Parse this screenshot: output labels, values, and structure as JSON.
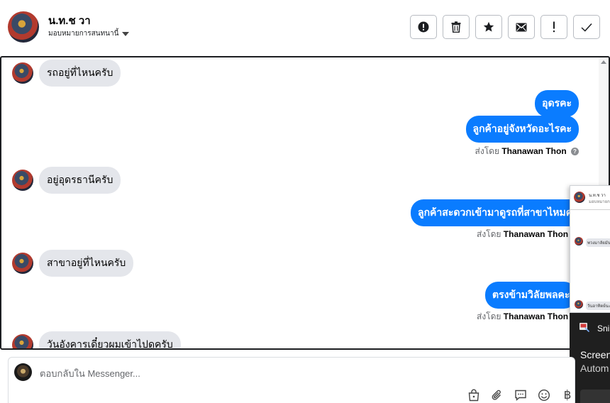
{
  "header": {
    "contact_name": "น.ท.ช วา",
    "assign_label": "มอบหมายการสนทนานี้"
  },
  "toolbar": {
    "buttons": [
      {
        "icon": "alert-circle-icon"
      },
      {
        "icon": "trash-icon"
      },
      {
        "icon": "star-icon"
      },
      {
        "icon": "envelope-icon"
      },
      {
        "icon": "exclamation-icon"
      },
      {
        "icon": "check-icon"
      }
    ]
  },
  "messages": [
    {
      "direction": "in",
      "text": "รถอยู่ที่ไหนครับ"
    },
    {
      "direction": "out",
      "text": "อุดรคะ"
    },
    {
      "direction": "out",
      "text": "ลูกค้าอยู่จังหวัดอะไรคะ"
    },
    {
      "direction": "meta",
      "prefix": "ส่งโดย",
      "sender": "Thanawan Thon"
    },
    {
      "direction": "in",
      "text": "อยู่อุดรธานีครับ"
    },
    {
      "direction": "out",
      "text": "ลูกค้าสะดวกเข้ามาดูรถที่สาขาไหมคะ"
    },
    {
      "direction": "meta",
      "prefix": "ส่งโดย",
      "sender": "Thanawan Thon"
    },
    {
      "direction": "in",
      "text": "สาขาอยู่ที่ไหนครับ"
    },
    {
      "direction": "out",
      "text": "ตรงข้ามวิลัยพลคะ"
    },
    {
      "direction": "meta",
      "prefix": "ส่งโดย",
      "sender": "Thanawan Thon"
    },
    {
      "direction": "in",
      "text": "วันอังคารเดี๋ยวผมเข้าไปดูครับ"
    }
  ],
  "thumbnail": {
    "name": "น.ท.ช วา",
    "sub": "มอบหมายการส",
    "msg1": "พวงมาลัยมัน",
    "msg2": "วันอาทิตย์นะ"
  },
  "snip_popup": {
    "app_name": "Sni",
    "title": "Screen",
    "subtitle": "Autom"
  },
  "composer": {
    "placeholder": "ตอบกลับใน Messenger..."
  },
  "composer_tools": {
    "baht_symbol": "฿"
  },
  "colors": {
    "outgoing_bubble": "#0a7cff",
    "incoming_bubble": "#e4e6eb"
  }
}
